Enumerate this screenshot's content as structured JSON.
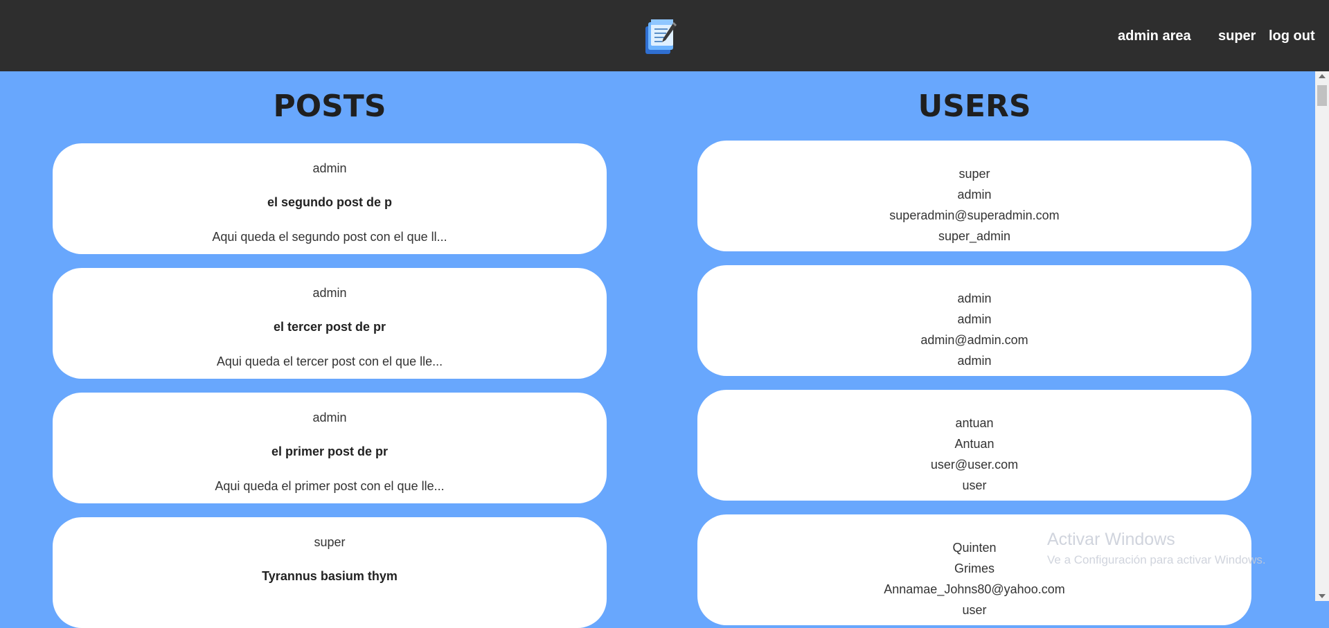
{
  "header": {
    "admin_area": "admin area",
    "user": "super",
    "logout": "log out"
  },
  "posts": {
    "title": "POSTS",
    "items": [
      {
        "author": "admin",
        "title": "el segundo post de p",
        "excerpt": "Aqui queda el segundo post con el que ll..."
      },
      {
        "author": "admin",
        "title": "el tercer post de pr",
        "excerpt": "Aqui queda el tercer post con el que lle..."
      },
      {
        "author": "admin",
        "title": "el primer post de pr",
        "excerpt": "Aqui queda el primer post con el que lle..."
      },
      {
        "author": "super",
        "title": "Tyrannus basium thym",
        "excerpt": ""
      }
    ]
  },
  "users": {
    "title": "USERS",
    "items": [
      {
        "username": "super",
        "name": "admin",
        "email": "superadmin@superadmin.com",
        "role": "super_admin"
      },
      {
        "username": "admin",
        "name": "admin",
        "email": "admin@admin.com",
        "role": "admin"
      },
      {
        "username": "antuan",
        "name": "Antuan",
        "email": "user@user.com",
        "role": "user"
      },
      {
        "username": "Quinten",
        "name": "Grimes",
        "email": "Annamae_Johns80@yahoo.com",
        "role": "user"
      }
    ]
  },
  "watermark": {
    "title": "Activar Windows",
    "subtitle": "Ve a Configuración para activar Windows."
  },
  "colors": {
    "background": "#68a7fd",
    "header": "#2e2e2e",
    "card": "#ffffff"
  }
}
